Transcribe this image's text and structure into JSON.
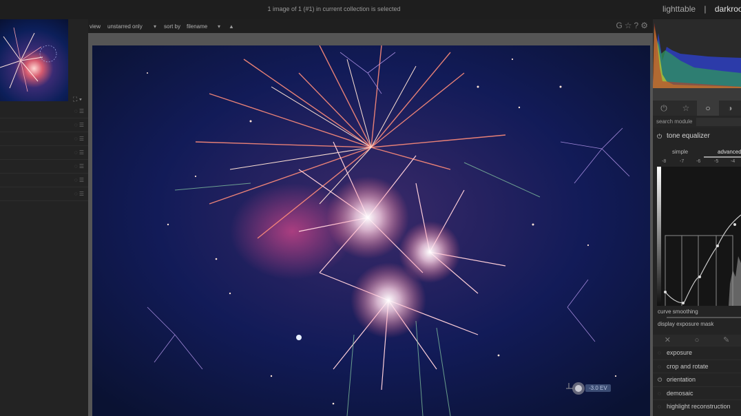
{
  "topbar": {
    "status": "1 image of 1 (#1) in current collection is selected",
    "views": [
      "lighttable",
      "|",
      "darkroo"
    ],
    "active_view": "darkroo"
  },
  "toolbar": {
    "view_label": "view",
    "view_value": "unstarred only",
    "sort_label": "sort by",
    "sort_value": "filename",
    "right_icons": [
      "G",
      "☆",
      "?",
      "⚙"
    ]
  },
  "left_panel": {
    "rows": 7
  },
  "photo": {
    "ev_badge": "-3.0 EV"
  },
  "right_panel": {
    "tabs": [
      "power-icon",
      "star-icon",
      "circle-icon",
      "half-circle-icon"
    ],
    "search_label": "search module",
    "module_title": "tone equalizer",
    "subtabs": [
      "simple",
      "advanced"
    ],
    "ticks": [
      "-8",
      "-7",
      "-6",
      "-5",
      "-4"
    ],
    "curve_smoothing": "curve smoothing",
    "display_mask": "display exposure mask",
    "modules": [
      "exposure",
      "crop and rotate",
      "orientation",
      "demosaic",
      "highlight reconstruction"
    ]
  },
  "colors": {
    "bg": "#1f1f1f",
    "panel": "#242424",
    "accent": "#d75b6f"
  }
}
